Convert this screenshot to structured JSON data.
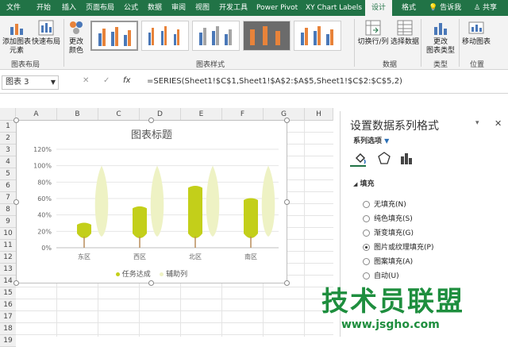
{
  "ribbon_tabs": [
    "文件",
    "开始",
    "插入",
    "页面布局",
    "公式",
    "数据",
    "审阅",
    "视图",
    "开发工具",
    "Power Pivot",
    "XY Chart Labels",
    "设计",
    "格式",
    "告诉我",
    "共享"
  ],
  "ribbon": {
    "add_element": "添加图表\n元素",
    "quick_layout": "快速布局",
    "change_color": "更改\n颜色",
    "group_layouts": "图表布局",
    "group_styles": "图表样式",
    "switch_rowcol": "切换行/列",
    "select_data": "选择数据",
    "group_data": "数据",
    "change_type": "更改\n图表类型",
    "group_type": "类型",
    "move_chart": "移动图表",
    "group_location": "位置"
  },
  "formula_bar": {
    "name_box": "图表 3",
    "cancel": "✕",
    "confirm": "✓",
    "fx": "fx",
    "formula": "=SERIES(Sheet1!$C$1,Sheet1!$A$2:$A$5,Sheet1!$C$2:$C$5,2)"
  },
  "columns": [
    "A",
    "B",
    "C",
    "D",
    "E",
    "F",
    "G",
    "H"
  ],
  "rows": [
    "1",
    "2",
    "3",
    "4",
    "5",
    "6",
    "7",
    "8",
    "9",
    "10",
    "11",
    "12",
    "13",
    "14",
    "15",
    "16",
    "17",
    "18",
    "19"
  ],
  "pane": {
    "title": "设置数据系列格式",
    "series_options": "系列选项",
    "section": "填充",
    "options": [
      {
        "label": "无填充(N)",
        "on": false
      },
      {
        "label": "纯色填充(S)",
        "on": false
      },
      {
        "label": "渐变填充(G)",
        "on": false
      },
      {
        "label": "图片或纹理填充(P)",
        "on": true
      },
      {
        "label": "图案填充(A)",
        "on": false
      },
      {
        "label": "自动(U)",
        "on": false
      }
    ],
    "close": "✕",
    "pin": "▾"
  },
  "chart_data": {
    "type": "bar",
    "title": "图表标题",
    "categories": [
      "东区",
      "西区",
      "北区",
      "南区"
    ],
    "series": [
      {
        "name": "任务达成",
        "values": [
          30,
          50,
          75,
          60
        ],
        "color": "#c3cf1a"
      },
      {
        "name": "辅助列",
        "values": [
          100,
          100,
          100,
          100
        ],
        "color": "#eef2c4"
      }
    ],
    "ylim": [
      0,
      120
    ],
    "yticks": [
      "0%",
      "20%",
      "40%",
      "60%",
      "80%",
      "100%",
      "120%"
    ],
    "legend_position": "bottom",
    "grid": true
  },
  "watermark": {
    "text": "技术员联盟",
    "url": "www.jsgho.com"
  },
  "colors": {
    "accent": "#217346",
    "series1": "#c3cf1a",
    "series2": "#eef2c4",
    "watermark": "#1e8e3e"
  }
}
